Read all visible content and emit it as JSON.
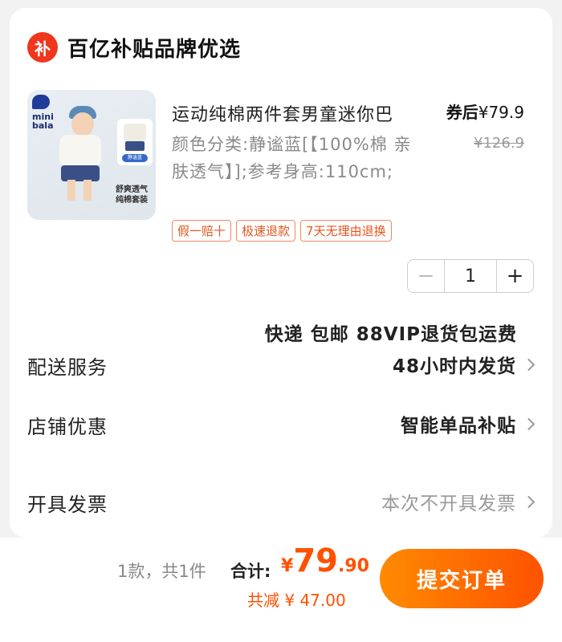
{
  "shop": {
    "logo_text": "补",
    "name": "百亿补贴品牌优选"
  },
  "product": {
    "image_icon": "product-thumbnail",
    "image_brand": "mini bala",
    "image_badge": "静谧蓝",
    "image_caption": "舒爽透气 纯棉套装",
    "title": "运动纯棉两件套男童迷你巴",
    "price_after_label": "券后",
    "price_after": "¥79.9",
    "price_original": "¥126.9",
    "spec": "颜色分类:静谧蓝[【100%棉 亲肤透气】];参考身高:110cm;",
    "tags": [
      "假一赔十",
      "极速退款",
      "7天无理由退换"
    ],
    "quantity": "1",
    "minus_symbol": "−",
    "plus_symbol": "+"
  },
  "delivery": {
    "label": "配送服务",
    "line1": "快递 包邮 88VIP退货包运费",
    "line2": "48小时内发货"
  },
  "store_discount": {
    "label": "店铺优惠",
    "value": "智能单品补贴"
  },
  "invoice": {
    "label": "开具发票",
    "value": "本次不开具发票"
  },
  "footer": {
    "count": "1款，共1件",
    "total_label": "合计:",
    "currency": "¥",
    "total_int": "79",
    "total_dec": ".90",
    "savings": "共减 ¥ 47.00",
    "submit_label": "提交订单"
  },
  "colors": {
    "accent": "#ff5000",
    "logo_red": "#f0361d",
    "tag_orange": "#e8551f"
  }
}
